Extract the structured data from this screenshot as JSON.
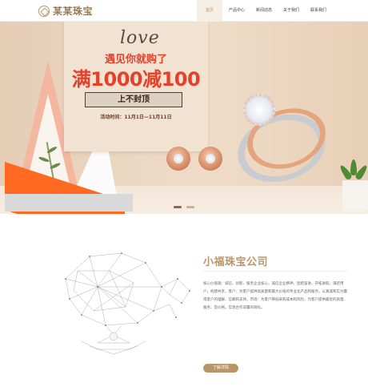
{
  "header": {
    "logo_text": "某某珠宝",
    "logo_icon": "diamond-emblem-icon",
    "nav": [
      "首页",
      "产品中心",
      "新闻动态",
      "关于我们",
      "联系我们"
    ],
    "active_index": 0
  },
  "hero": {
    "script_word": "love",
    "headline_1": "遇见你就购了",
    "headline_2": "满1000减100",
    "cap_label": "上不封顶",
    "period": "活动时间：11月1日—11月11日",
    "slide_count": 2,
    "active_slide": 0
  },
  "about": {
    "title": "小福珠宝公司",
    "body": "核心价值观：诚信、创新、服务企业核心，诚信企业精神，团结奋进，开拓进取，满足用户，构建共享。客户：为客户提供高质量和最大价值的专业化产品和服务，以真诚和实力赢得客户的理解、信赖和支持。市场：为客户降低采购成本和风险，为客户提供最优的质量、服务、及价格，实现合作双赢的目标。",
    "more_button": "了解详情"
  },
  "colors": {
    "brand": "#b8966a",
    "headline_red": "#e4402a",
    "orange_accent": "#ff6a23"
  }
}
